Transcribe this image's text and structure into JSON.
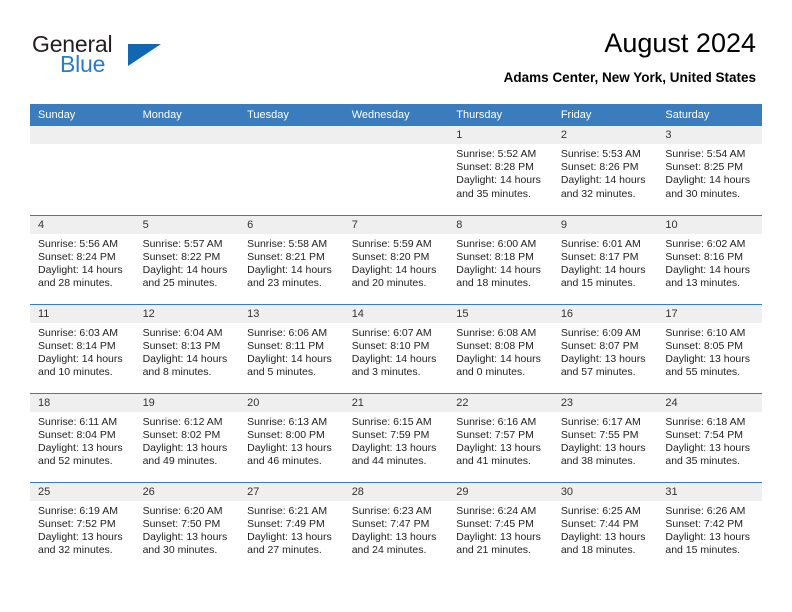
{
  "brand": {
    "name_top": "General",
    "name_bottom": "Blue",
    "triangle_icon": "triangle-icon",
    "color_dark": "#231f20",
    "color_blue": "#2a7cc7"
  },
  "header": {
    "title": "August 2024",
    "subtitle": "Adams Center, New York, United States",
    "accent_color": "#3a7cbe"
  },
  "calendar": {
    "weekday_headers": [
      "Sunday",
      "Monday",
      "Tuesday",
      "Wednesday",
      "Thursday",
      "Friday",
      "Saturday"
    ],
    "weeks": [
      [
        {
          "day": "",
          "sunrise": "",
          "sunset": "",
          "daylight_1": "",
          "daylight_2": "",
          "empty": true
        },
        {
          "day": "",
          "sunrise": "",
          "sunset": "",
          "daylight_1": "",
          "daylight_2": "",
          "empty": true
        },
        {
          "day": "",
          "sunrise": "",
          "sunset": "",
          "daylight_1": "",
          "daylight_2": "",
          "empty": true
        },
        {
          "day": "",
          "sunrise": "",
          "sunset": "",
          "daylight_1": "",
          "daylight_2": "",
          "empty": true
        },
        {
          "day": "1",
          "sunrise": "Sunrise: 5:52 AM",
          "sunset": "Sunset: 8:28 PM",
          "daylight_1": "Daylight: 14 hours",
          "daylight_2": "and 35 minutes."
        },
        {
          "day": "2",
          "sunrise": "Sunrise: 5:53 AM",
          "sunset": "Sunset: 8:26 PM",
          "daylight_1": "Daylight: 14 hours",
          "daylight_2": "and 32 minutes."
        },
        {
          "day": "3",
          "sunrise": "Sunrise: 5:54 AM",
          "sunset": "Sunset: 8:25 PM",
          "daylight_1": "Daylight: 14 hours",
          "daylight_2": "and 30 minutes."
        }
      ],
      [
        {
          "day": "4",
          "sunrise": "Sunrise: 5:56 AM",
          "sunset": "Sunset: 8:24 PM",
          "daylight_1": "Daylight: 14 hours",
          "daylight_2": "and 28 minutes."
        },
        {
          "day": "5",
          "sunrise": "Sunrise: 5:57 AM",
          "sunset": "Sunset: 8:22 PM",
          "daylight_1": "Daylight: 14 hours",
          "daylight_2": "and 25 minutes."
        },
        {
          "day": "6",
          "sunrise": "Sunrise: 5:58 AM",
          "sunset": "Sunset: 8:21 PM",
          "daylight_1": "Daylight: 14 hours",
          "daylight_2": "and 23 minutes."
        },
        {
          "day": "7",
          "sunrise": "Sunrise: 5:59 AM",
          "sunset": "Sunset: 8:20 PM",
          "daylight_1": "Daylight: 14 hours",
          "daylight_2": "and 20 minutes."
        },
        {
          "day": "8",
          "sunrise": "Sunrise: 6:00 AM",
          "sunset": "Sunset: 8:18 PM",
          "daylight_1": "Daylight: 14 hours",
          "daylight_2": "and 18 minutes."
        },
        {
          "day": "9",
          "sunrise": "Sunrise: 6:01 AM",
          "sunset": "Sunset: 8:17 PM",
          "daylight_1": "Daylight: 14 hours",
          "daylight_2": "and 15 minutes."
        },
        {
          "day": "10",
          "sunrise": "Sunrise: 6:02 AM",
          "sunset": "Sunset: 8:16 PM",
          "daylight_1": "Daylight: 14 hours",
          "daylight_2": "and 13 minutes."
        }
      ],
      [
        {
          "day": "11",
          "sunrise": "Sunrise: 6:03 AM",
          "sunset": "Sunset: 8:14 PM",
          "daylight_1": "Daylight: 14 hours",
          "daylight_2": "and 10 minutes."
        },
        {
          "day": "12",
          "sunrise": "Sunrise: 6:04 AM",
          "sunset": "Sunset: 8:13 PM",
          "daylight_1": "Daylight: 14 hours",
          "daylight_2": "and 8 minutes."
        },
        {
          "day": "13",
          "sunrise": "Sunrise: 6:06 AM",
          "sunset": "Sunset: 8:11 PM",
          "daylight_1": "Daylight: 14 hours",
          "daylight_2": "and 5 minutes."
        },
        {
          "day": "14",
          "sunrise": "Sunrise: 6:07 AM",
          "sunset": "Sunset: 8:10 PM",
          "daylight_1": "Daylight: 14 hours",
          "daylight_2": "and 3 minutes."
        },
        {
          "day": "15",
          "sunrise": "Sunrise: 6:08 AM",
          "sunset": "Sunset: 8:08 PM",
          "daylight_1": "Daylight: 14 hours",
          "daylight_2": "and 0 minutes."
        },
        {
          "day": "16",
          "sunrise": "Sunrise: 6:09 AM",
          "sunset": "Sunset: 8:07 PM",
          "daylight_1": "Daylight: 13 hours",
          "daylight_2": "and 57 minutes."
        },
        {
          "day": "17",
          "sunrise": "Sunrise: 6:10 AM",
          "sunset": "Sunset: 8:05 PM",
          "daylight_1": "Daylight: 13 hours",
          "daylight_2": "and 55 minutes."
        }
      ],
      [
        {
          "day": "18",
          "sunrise": "Sunrise: 6:11 AM",
          "sunset": "Sunset: 8:04 PM",
          "daylight_1": "Daylight: 13 hours",
          "daylight_2": "and 52 minutes."
        },
        {
          "day": "19",
          "sunrise": "Sunrise: 6:12 AM",
          "sunset": "Sunset: 8:02 PM",
          "daylight_1": "Daylight: 13 hours",
          "daylight_2": "and 49 minutes."
        },
        {
          "day": "20",
          "sunrise": "Sunrise: 6:13 AM",
          "sunset": "Sunset: 8:00 PM",
          "daylight_1": "Daylight: 13 hours",
          "daylight_2": "and 46 minutes."
        },
        {
          "day": "21",
          "sunrise": "Sunrise: 6:15 AM",
          "sunset": "Sunset: 7:59 PM",
          "daylight_1": "Daylight: 13 hours",
          "daylight_2": "and 44 minutes."
        },
        {
          "day": "22",
          "sunrise": "Sunrise: 6:16 AM",
          "sunset": "Sunset: 7:57 PM",
          "daylight_1": "Daylight: 13 hours",
          "daylight_2": "and 41 minutes."
        },
        {
          "day": "23",
          "sunrise": "Sunrise: 6:17 AM",
          "sunset": "Sunset: 7:55 PM",
          "daylight_1": "Daylight: 13 hours",
          "daylight_2": "and 38 minutes."
        },
        {
          "day": "24",
          "sunrise": "Sunrise: 6:18 AM",
          "sunset": "Sunset: 7:54 PM",
          "daylight_1": "Daylight: 13 hours",
          "daylight_2": "and 35 minutes."
        }
      ],
      [
        {
          "day": "25",
          "sunrise": "Sunrise: 6:19 AM",
          "sunset": "Sunset: 7:52 PM",
          "daylight_1": "Daylight: 13 hours",
          "daylight_2": "and 32 minutes."
        },
        {
          "day": "26",
          "sunrise": "Sunrise: 6:20 AM",
          "sunset": "Sunset: 7:50 PM",
          "daylight_1": "Daylight: 13 hours",
          "daylight_2": "and 30 minutes."
        },
        {
          "day": "27",
          "sunrise": "Sunrise: 6:21 AM",
          "sunset": "Sunset: 7:49 PM",
          "daylight_1": "Daylight: 13 hours",
          "daylight_2": "and 27 minutes."
        },
        {
          "day": "28",
          "sunrise": "Sunrise: 6:23 AM",
          "sunset": "Sunset: 7:47 PM",
          "daylight_1": "Daylight: 13 hours",
          "daylight_2": "and 24 minutes."
        },
        {
          "day": "29",
          "sunrise": "Sunrise: 6:24 AM",
          "sunset": "Sunset: 7:45 PM",
          "daylight_1": "Daylight: 13 hours",
          "daylight_2": "and 21 minutes."
        },
        {
          "day": "30",
          "sunrise": "Sunrise: 6:25 AM",
          "sunset": "Sunset: 7:44 PM",
          "daylight_1": "Daylight: 13 hours",
          "daylight_2": "and 18 minutes."
        },
        {
          "day": "31",
          "sunrise": "Sunrise: 6:26 AM",
          "sunset": "Sunset: 7:42 PM",
          "daylight_1": "Daylight: 13 hours",
          "daylight_2": "and 15 minutes."
        }
      ]
    ]
  }
}
